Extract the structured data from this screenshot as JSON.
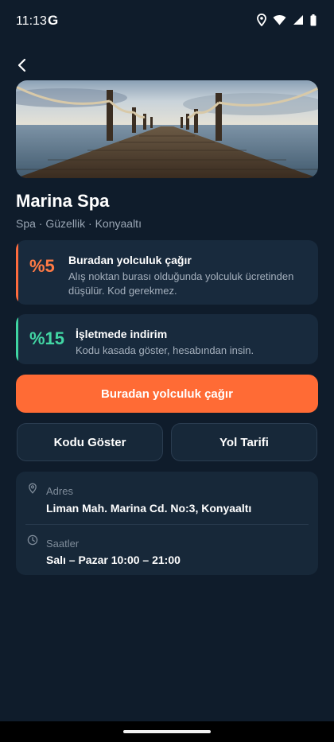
{
  "status_bar": {
    "time": "11:13",
    "g_logo": "G",
    "icons": [
      "location-icon",
      "wifi-icon",
      "signal-icon",
      "battery-icon"
    ]
  },
  "header": {
    "back_icon": "back-arrow-icon"
  },
  "place": {
    "name": "Marina Spa",
    "meta": "Spa · Güzellik · Konyaaltı"
  },
  "offers": [
    {
      "percent": "%5",
      "title": "Buradan yolculuk çağır",
      "description": "Alış noktan burası olduğunda yolculuk ücretinden düşülür. Kod gerekmez.",
      "accent_color": "#ff6b3d"
    },
    {
      "percent": "%15",
      "title": "İşletmede indirim",
      "description": "Kodu kasada göster, hesabından insin.",
      "accent_color": "#3fd4a1"
    }
  ],
  "actions": {
    "primary_label": "Buradan yolculuk çağır",
    "show_code_label": "Kodu Göster",
    "directions_label": "Yol Tarifi"
  },
  "info": {
    "address_label": "Adres",
    "address_value": "Liman Mah. Marina Cd. No:3, Konyaaltı",
    "address_icon": "location-pin-icon",
    "hours_label": "Saatler",
    "hours_value": "Salı – Pazar 10:00 – 21:00",
    "hours_icon": "clock-icon"
  },
  "colors": {
    "background": "#0f1c2b",
    "card": "#182a3d",
    "primary": "#ff6b35",
    "accent_green": "#42d6a4"
  }
}
